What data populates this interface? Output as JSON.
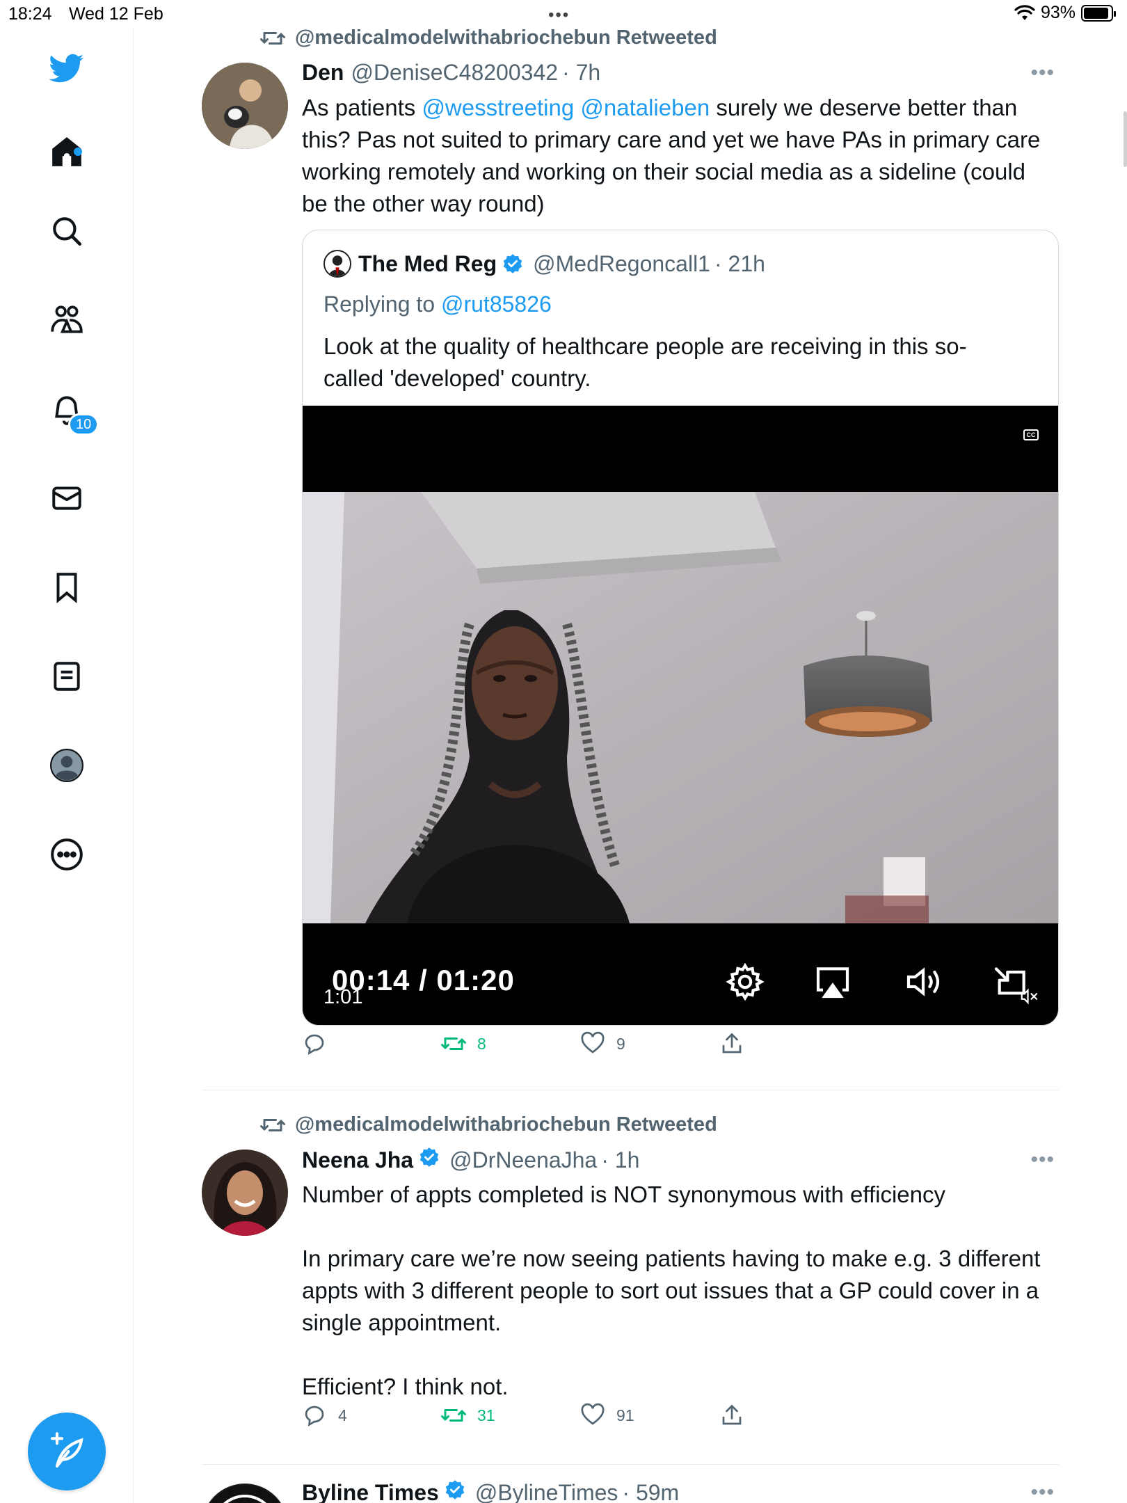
{
  "status_bar": {
    "time": "18:24",
    "date": "Wed 12 Feb",
    "dots": "•••",
    "battery": "93%",
    "battery_level": 0.93
  },
  "sidebar": {
    "items": [
      {
        "icon": "twitter-logo-icon"
      },
      {
        "icon": "home-icon",
        "has_dot": true
      },
      {
        "icon": "search-icon"
      },
      {
        "icon": "communities-icon"
      },
      {
        "icon": "notifications-icon",
        "badge": "10"
      },
      {
        "icon": "messages-icon"
      },
      {
        "icon": "bookmarks-icon"
      },
      {
        "icon": "lists-icon"
      },
      {
        "icon": "profile-icon"
      },
      {
        "icon": "more-icon"
      }
    ],
    "compose_icon": "compose-feather-icon"
  },
  "colors": {
    "accent": "#1d9bf0",
    "retweet_green": "#00ba7c",
    "secondary_text": "#536471"
  },
  "feed": {
    "tweets": [
      {
        "retweeted_by": "@medicalmodelwithabriochebun Retweeted",
        "name": "Den",
        "handle": "@DeniseC48200342",
        "time": "· 7h",
        "more": "•••",
        "text_mention_1": "@wesstreeting",
        "text_mention_2": "@natalieben",
        "text_prefix": "As patients ",
        "text_rest": " surely we deserve better than this? Pas not suited to primary care and yet we have PAs in primary care working remotely and working on their social media as a sideline (could be the other way round)",
        "quote": {
          "name": "The Med Reg",
          "handle": "@MedRegoncall1",
          "time": "· 21h",
          "replying_label": "Replying to ",
          "replying_to": "@rut85826",
          "text": "Look at the quality of healthcare people are receiving in this so-called 'developed' country.",
          "video": {
            "caption_label": "CC",
            "overlay_time": "00:14 / 01:20",
            "duration": "1:01"
          }
        },
        "actions": {
          "replies": "",
          "retweets": "8",
          "likes": "9"
        }
      },
      {
        "retweeted_by": "@medicalmodelwithabriochebun Retweeted",
        "name": "Neena Jha",
        "handle": "@DrNeenaJha",
        "time": "· 1h",
        "more": "•••",
        "para_1": "Number of appts completed is NOT synonymous with efficiency",
        "para_2": "In primary care we’re now seeing patients having to make e.g. 3 different appts with 3 different people to sort out issues that a GP could cover in a single appointment.",
        "para_3": "Efficient? I think not.",
        "actions": {
          "replies": "4",
          "retweets": "31",
          "likes": "91"
        }
      },
      {
        "name": "Byline Times",
        "handle": "@BylineTimes",
        "time": "· 59m",
        "more": "•••"
      }
    ]
  }
}
